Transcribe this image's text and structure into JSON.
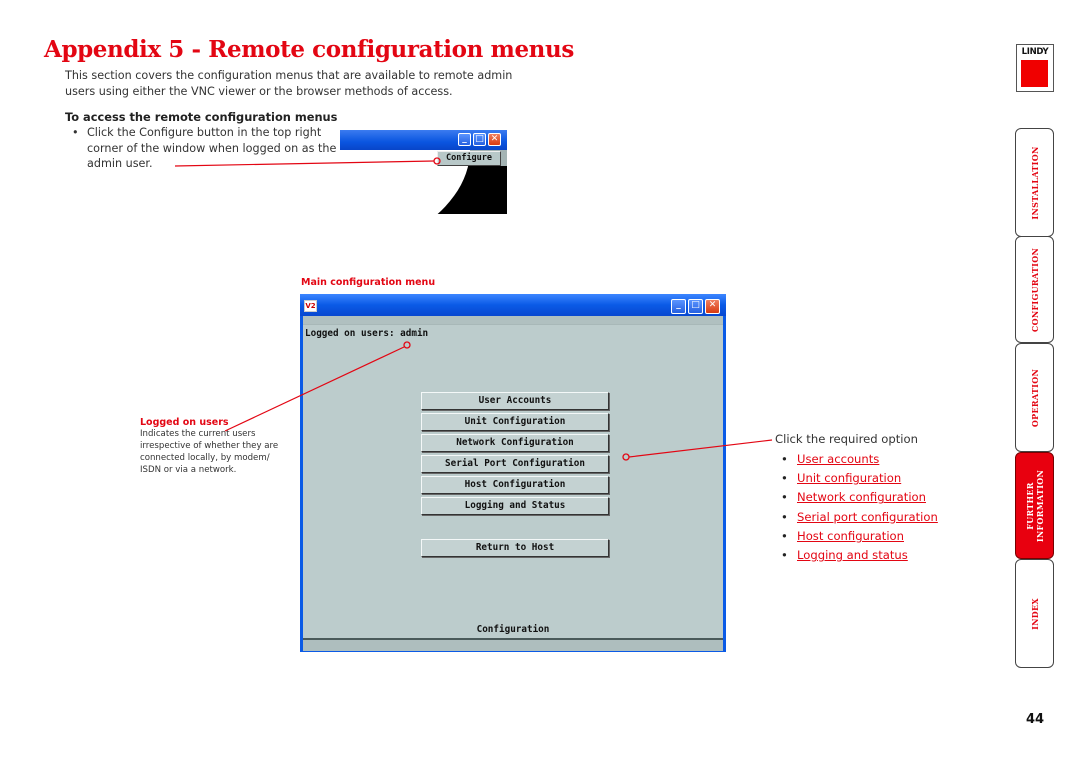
{
  "page": {
    "title": "Appendix 5 - Remote configuration menus",
    "intro": "This section covers the configuration menus that are available to remote admin users using either the VNC viewer or the browser methods of access.",
    "subheading": "To access the remote configuration menus",
    "bullet": "Click the Configure button in the top right corner of the window when logged on as the admin user.",
    "page_number": "44"
  },
  "configure_crop": {
    "button_label": "Configure",
    "icons": [
      "minimize-icon",
      "maximize-icon",
      "close-icon"
    ]
  },
  "main_window": {
    "caption": "Main configuration menu",
    "logo_text": "V2",
    "logged_on_label": "Logged on users:  admin",
    "menu_buttons": [
      "User Accounts",
      "Unit Configuration",
      "Network Configuration",
      "Serial Port Configuration",
      "Host Configuration",
      "Logging and Status"
    ],
    "return_button": "Return to Host",
    "footer_label": "Configuration"
  },
  "callout_logged": {
    "heading": "Logged on users",
    "body": "Indicates the current users irrespective of whether they are connected locally, by modem/ ISDN or via a network."
  },
  "callout_options": {
    "lead": "Click the required option",
    "links": [
      "User accounts",
      "Unit configuration",
      "Network configuration",
      "Serial port configuration",
      "Host configuration",
      "Logging and status"
    ]
  },
  "sidebar": {
    "logo_text": "LINDY",
    "tabs": [
      {
        "label": "INSTALLATION",
        "active": false
      },
      {
        "label": "CONFIGURATION",
        "active": false
      },
      {
        "label": "OPERATION",
        "active": false
      },
      {
        "label": "FURTHER INFORMATION",
        "active": true
      },
      {
        "label": "INDEX",
        "active": false
      }
    ]
  },
  "colors": {
    "accent_red": "#e30613",
    "window_blue": "#0a5ae6",
    "client_grey": "#bccccc"
  }
}
